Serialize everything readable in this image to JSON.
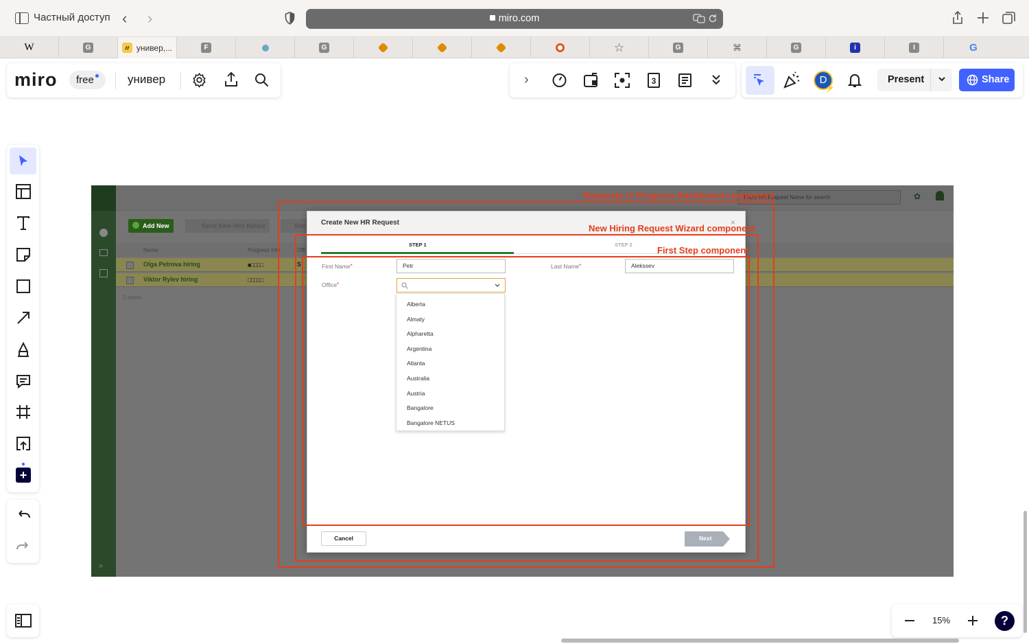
{
  "browser": {
    "private_label": "Частный доступ",
    "url": "miro.com",
    "active_tab_label": "универ,...",
    "tabs": [
      "W",
      "G",
      "",
      "F",
      "",
      "G",
      "",
      "",
      "",
      "",
      "",
      "G",
      "",
      "G",
      "i",
      "I",
      "G"
    ]
  },
  "miro": {
    "logo": "miro",
    "plan_badge": "free",
    "board_name": "универ",
    "avatar_letter": "D",
    "present_label": "Present",
    "share_label": "Share",
    "zoom_level": "15%",
    "help_label": "?",
    "accent_color": "#4262ff"
  },
  "board_image": {
    "add_new_label": "Add New",
    "send_notice_label": "Send New Hire Notice",
    "send_label": "Sen",
    "search_placeholder": "Enter HR Request Name for search",
    "col_name": "Name",
    "col_progress": "Progress Info",
    "col_office": "Offi",
    "rows": [
      {
        "name": "Olga Petrova hiring",
        "progress": "■□□□□",
        "extra": "S"
      },
      {
        "name": "Viktor Rylev hiring",
        "progress": "□□□□□",
        "extra": ""
      }
    ],
    "items_count": "2 items",
    "modal": {
      "title": "Create New HR Request",
      "close": "×",
      "step1": "STEP 1",
      "step2": "STEP 2",
      "first_name_label": "First Name",
      "first_name_value": "Petr",
      "last_name_label": "Last Name",
      "last_name_value": "Alekssev",
      "office_label": "Office",
      "required_mark": "*",
      "office_options": [
        "Alberta",
        "Almaty",
        "Alpharetta",
        "Argentina",
        "Atlanta",
        "Australia",
        "Austria",
        "Bangalore",
        "Bangalore NETUS"
      ],
      "cancel_label": "Cancel",
      "next_label": "Next"
    }
  },
  "annotations": {
    "dashboard": "Requests in Progress Dashboard component",
    "wizard": "New Hiring Request Wizard component",
    "first_step": "First Step component",
    "color": "#e53d1a"
  }
}
